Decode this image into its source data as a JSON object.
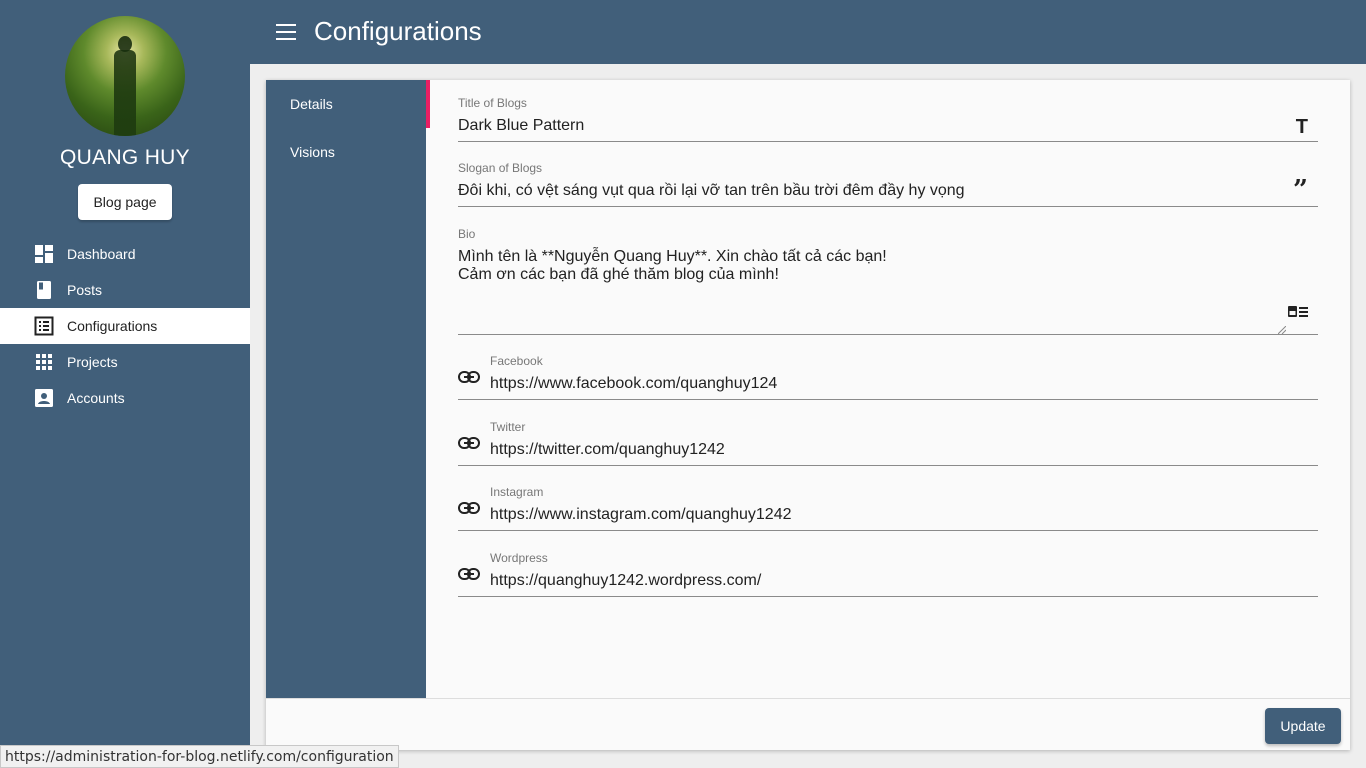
{
  "colors": {
    "primary": "#415f7a",
    "accent": "#e91e63",
    "background": "#eeeeee"
  },
  "sidebar": {
    "user_name": "QUANG HUY",
    "blog_button": "Blog page",
    "items": [
      {
        "label": "Dashboard",
        "icon": "dashboard-icon"
      },
      {
        "label": "Posts",
        "icon": "book-icon"
      },
      {
        "label": "Configurations",
        "icon": "list-alt-icon",
        "active": true
      },
      {
        "label": "Projects",
        "icon": "apps-grid-icon"
      },
      {
        "label": "Accounts",
        "icon": "account-box-icon"
      }
    ]
  },
  "header": {
    "title": "Configurations",
    "menu_icon": "menu-icon"
  },
  "tabs": [
    {
      "label": "Details",
      "active": true
    },
    {
      "label": "Visions"
    }
  ],
  "form": {
    "title": {
      "label": "Title of Blogs",
      "value": "Dark Blue Pattern",
      "icon": "text-format-icon"
    },
    "slogan": {
      "label": "Slogan of Blogs",
      "value": "Đôi khi, có vệt sáng vụt qua rồi lại vỡ tan trên bầu trời đêm đầy hy vọng",
      "icon": "format-quote-icon"
    },
    "bio": {
      "label": "Bio",
      "value": "Mình tên là **Nguyễn Quang Huy**. Xin chào tất cả các bạn!\nCảm ơn các bạn đã ghé thăm blog của mình!",
      "icon": "featured-play-list-icon"
    },
    "facebook": {
      "label": "Facebook",
      "value": "https://www.facebook.com/quanghuy124",
      "icon": "link-icon"
    },
    "twitter": {
      "label": "Twitter",
      "value": "https://twitter.com/quanghuy1242",
      "icon": "link-icon"
    },
    "instagram": {
      "label": "Instagram",
      "value": "https://www.instagram.com/quanghuy1242",
      "icon": "link-icon"
    },
    "wordpress": {
      "label": "Wordpress",
      "value": "https://quanghuy1242.wordpress.com/",
      "icon": "link-icon"
    }
  },
  "footer": {
    "update_label": "Update"
  },
  "status_bar": {
    "url": "https://administration-for-blog.netlify.com/configuration"
  }
}
